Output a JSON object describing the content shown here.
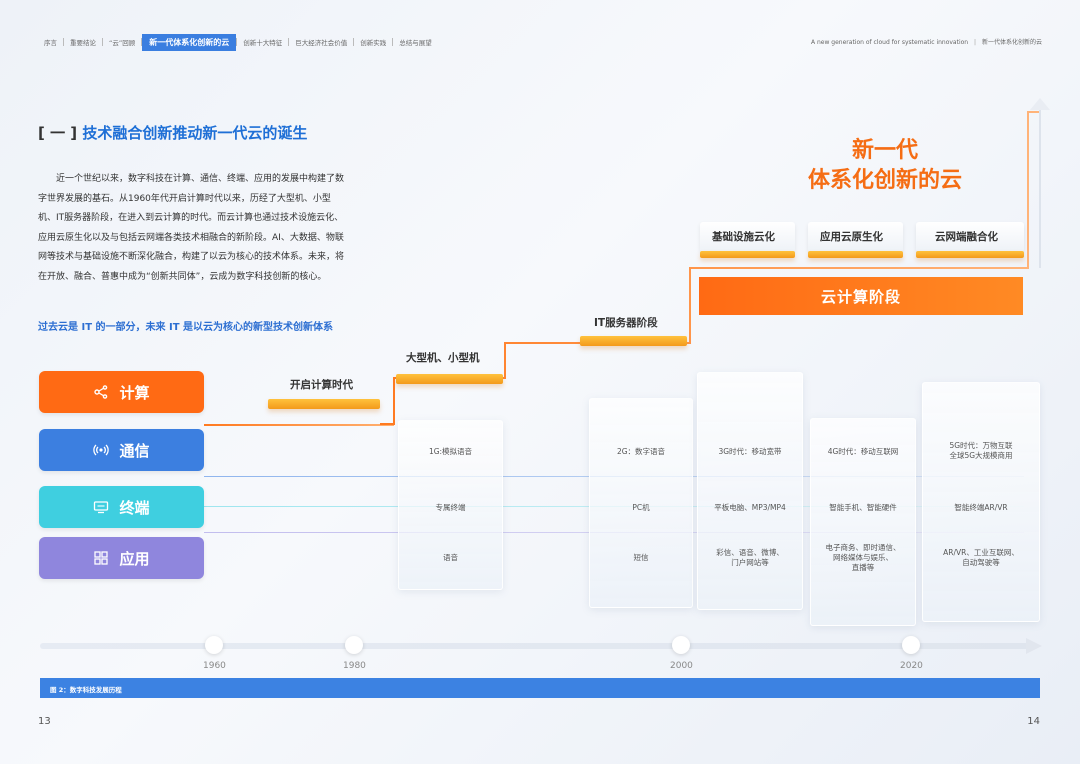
{
  "nav": {
    "items": [
      "序言",
      "重要结论",
      "“云”回顾",
      "新一代体系化创新的云",
      "创新十大特征",
      "巨大经济社会价值",
      "创新实践",
      "总结与展望"
    ],
    "active_index": 3,
    "right_en": "A new generation of cloud for systematic innovation",
    "right_cn": "新一代体系化创新的云"
  },
  "section": {
    "bracket": "[ 一 ]",
    "title": "技术融合创新推动新一代云的诞生"
  },
  "paragraph": "近一个世纪以来，数字科技在计算、通信、终端、应用的发展中构建了数字世界发展的基石。从1960年代开启计算时代以来，历经了大型机、小型机、IT服务器阶段，在进入到云计算的时代。而云计算也通过技术设施云化、应用云原生化以及与包括云网端各类技术相融合的新阶段。AI、大数据、物联网等技术与基础设施不断深化融合，构建了以云为核心的技术体系。未来，将在开放、融合、普惠中成为“创新共同体”，云成为数字科技创新的核心。",
  "highlight": "过去云是 IT 的一部分，未来 IT 是以云为核心的新型技术创新体系",
  "categories": [
    {
      "label": "计算",
      "icon": "compute-icon",
      "color": "#ff6a14"
    },
    {
      "label": "通信",
      "icon": "signal-icon",
      "color": "#3c7fe0"
    },
    {
      "label": "终端",
      "icon": "monitor-icon",
      "color": "#3fcfe0"
    },
    {
      "label": "应用",
      "icon": "apps-grid-icon",
      "color": "#8f86dd"
    }
  ],
  "stairs": {
    "step1": "开启计算时代",
    "step2": "大型机、小型机",
    "step3": "IT服务器阶段",
    "cloud": "云计算阶段",
    "sub": [
      "基础设施云化",
      "应用云原生化",
      "云网端融合化"
    ],
    "new_title_1": "新一代",
    "new_title_2": "体系化创新的云"
  },
  "columns": [
    {
      "comm": "1G:模拟语音",
      "term": "专属终端",
      "app": "语音"
    },
    {
      "comm": "2G：数字语音",
      "term": "PC机",
      "app": "短信"
    },
    {
      "comm": "3G时代：移动宽带",
      "term": "平板电脑、MP3/MP4",
      "app": "彩信、语音、微博、\n门户网站等"
    },
    {
      "comm": "4G时代：移动互联网",
      "term": "智能手机、智能硬件",
      "app": "电子商务、即时通信、\n网络媒体与娱乐、\n直播等"
    },
    {
      "comm": "5G时代：万物互联\n全球5G大规模商用",
      "term": "智能终端AR/VR",
      "app": "AR/VR、工业互联网、\n自动驾驶等"
    }
  ],
  "timeline": {
    "years": [
      "1960",
      "1980",
      "2000",
      "2020"
    ]
  },
  "caption": "图 2：数字科技发展历程",
  "pages": {
    "left": "13",
    "right": "14"
  }
}
